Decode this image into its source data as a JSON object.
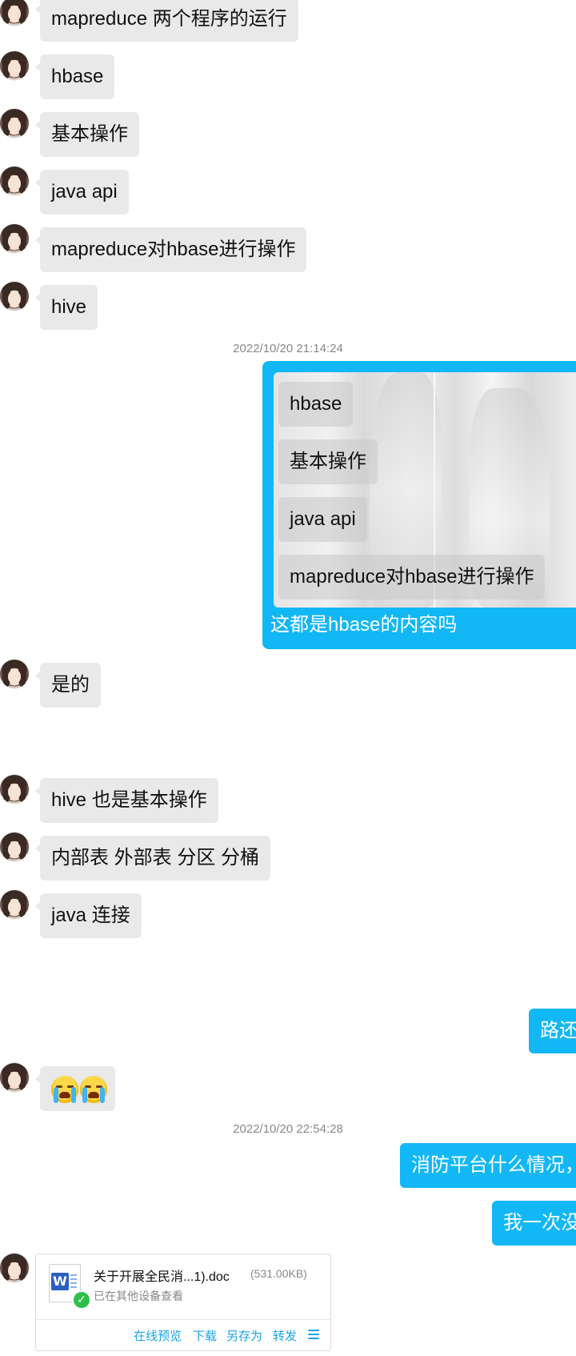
{
  "messages_in": [
    {
      "text": "mapreduce 两个程序的运行"
    },
    {
      "text": "hbase"
    },
    {
      "text": "基本操作"
    },
    {
      "text": "java api"
    },
    {
      "text": "mapreduce对hbase进行操作"
    },
    {
      "text": "hive"
    },
    {
      "text": "是的"
    },
    {
      "text": "hive 也是基本操作"
    },
    {
      "text": "内部表 外部表 分区 分桶"
    },
    {
      "text": "java 连接"
    }
  ],
  "timestamps": [
    "2022/10/20 21:14:24",
    "2022/10/20 22:54:28"
  ],
  "quote": {
    "items": [
      "hbase",
      "基本操作",
      "java api",
      "mapreduce对hbase进行操作"
    ],
    "reply": "这都是hbase的内容吗"
  },
  "messages_out": [
    {
      "text": "路还"
    },
    {
      "text": "消防平台什么情况，"
    },
    {
      "text": "我一次没"
    }
  ],
  "emoji": {
    "name": "loudly-crying-face",
    "count": 2
  },
  "file": {
    "name": "关于开展全民消...1).doc",
    "size": "(531.00KB)",
    "status": "已在其他设备查看",
    "icon": "word-doc-icon",
    "actions": [
      "在线预览",
      "下载",
      "另存为",
      "转发"
    ]
  },
  "colors": {
    "outgoing_bubble": "#12b7f5",
    "incoming_bubble": "#e9e9e9",
    "action_link": "#1aa4e8"
  }
}
